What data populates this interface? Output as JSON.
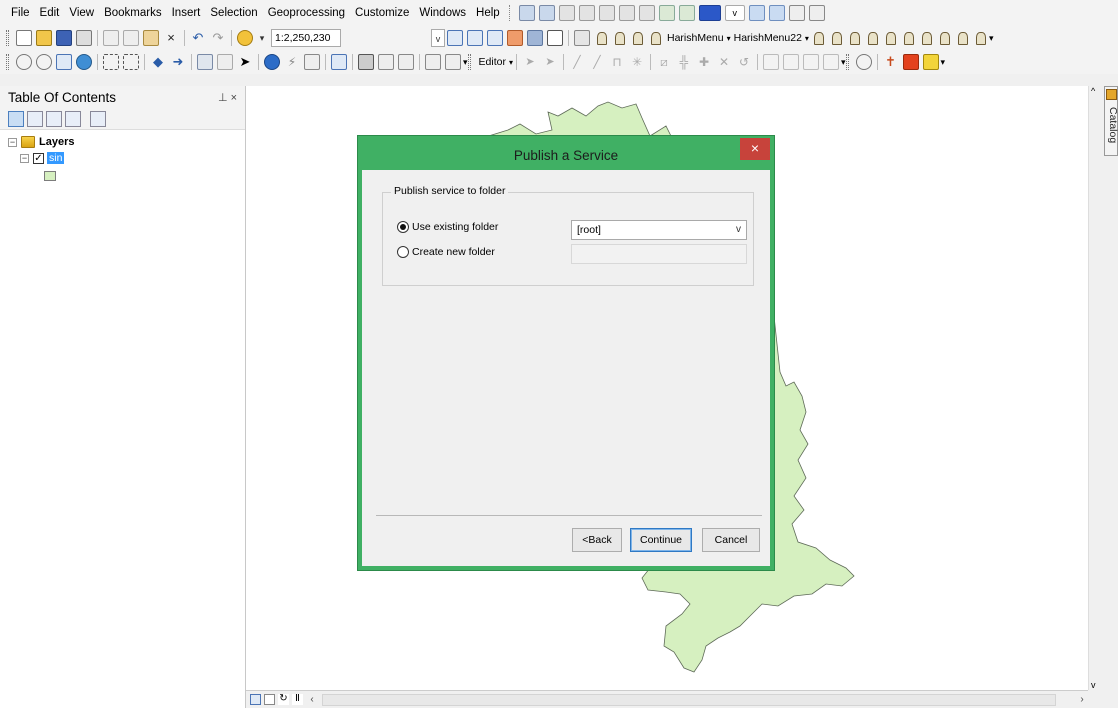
{
  "menubar": {
    "items": [
      "File",
      "Edit",
      "View",
      "Bookmarks",
      "Insert",
      "Selection",
      "Geoprocessing",
      "Customize",
      "Windows",
      "Help"
    ]
  },
  "toolbar": {
    "scale_value": "1:2,250,230",
    "custom_menus": [
      "HarishMenu",
      "HarishMenu22"
    ],
    "editor_label": "Editor"
  },
  "toc": {
    "title": "Table Of Contents",
    "pin_glyph": "⊥ ×",
    "root_label": "Layers",
    "layer_label": "sin"
  },
  "dialog": {
    "title": "Publish a Service",
    "close_glyph": "×",
    "group_label": "Publish service to folder",
    "option_existing": "Use existing folder",
    "option_new": "Create new folder",
    "selected_folder": "[root]",
    "back_label": "<Back",
    "continue_label": "Continue",
    "cancel_label": "Cancel"
  },
  "catalog_tab": {
    "label": "Catalog"
  },
  "colors": {
    "dialog_frame": "#40b064",
    "close_button": "#c7433b",
    "map_fill": "#d6f0c0",
    "selection": "#3399ff"
  }
}
